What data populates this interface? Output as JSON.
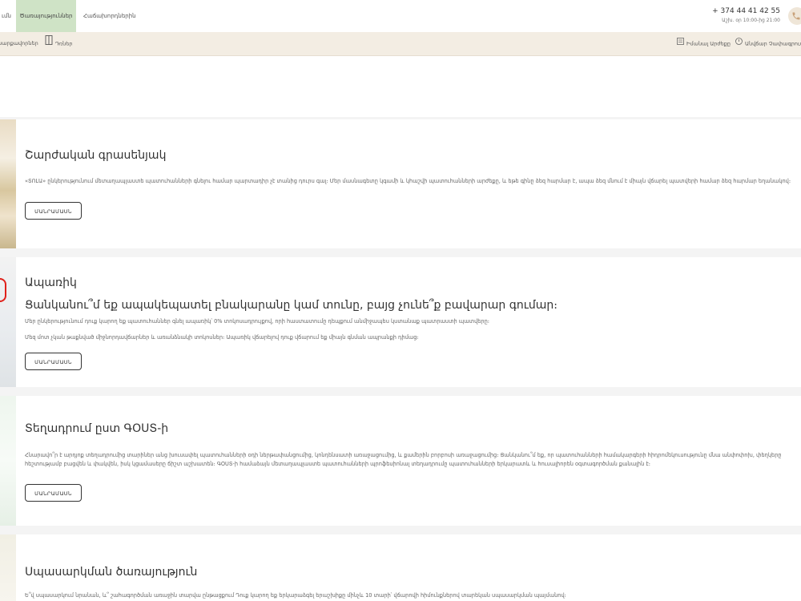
{
  "nav": {
    "items": [
      {
        "label": "ւմն"
      },
      {
        "label": "Ծառայություններ"
      },
      {
        "label": "Հաճախորդներին"
      }
    ]
  },
  "contact": {
    "phone": "+ 374 44 41 42 55",
    "hours": "Աշխ. օր 10:00-ից 21:00"
  },
  "subnav": {
    "left": [
      {
        "label": "սարքավորներ"
      },
      {
        "label": "Դռներ"
      }
    ],
    "right": [
      {
        "label": "Իմանալ Արժեքը"
      },
      {
        "label": "Անվճար Չափագրում"
      }
    ]
  },
  "cards": [
    {
      "title": "Շարժական գրասենյակ",
      "text": "«ՏՈԼԱ» ընկերությունում մետաղապլաստե պատուհանների գնելու համար պարտադիր չէ տանից դուրս գալ։ Մեր մասնագետը կգամի և կհաշվի պատուհանների արժեքը, և եթե գինը ձեզ հարմար է, ապա ձեզ մնում է միայն վճարել պատվերի համար ձեզ հարմար եղանակով։",
      "button": "ՄԱՆՐԱՄԱՍՆ"
    },
    {
      "title": "Ապառիկ",
      "subtitle": "Ցանկանու՞մ եք ապակեպատել բնակարանը կամ տունը, բայց չունե՞ք բավարար գումար։",
      "text": "Մեր ընկերությունում դուք կարող եք պատուհաններ գնել ապառիկ՝ 0% տոկոսադրույքով, որի հաստատումը դեպքում անմիջապես կստանաք պատրաստի պատվերը։",
      "text2": "Մեզ մոտ չկան թաքնված միջնորդավճարներ և առանձնակի տոկոսներ։ Ապառիկ վճարելով դուք վճարում եք միայն գնման ապրանքի դիմաց։",
      "button": "ՄԱՆՐԱՄԱՍՆ"
    },
    {
      "title": "Տեղադրում ըստ ԳՕՍՏ-ի",
      "text": "Հնարավո՞ր է արդյոք տեղադրումից տարիներ անց խուսափել պատուհանների օդի ներթափանցումից, կոնդենսատի առաջացումից, և քամերին բորբոսի առաջացումից։ Ցանկանու՞մ եք, որ պատուհանների համակարգերի հիդրոմեկուսությունը մնա անփոփոխ, փեղկերը հեշտությամբ բացվեն և փակվեն, իսկ կցամասերը ճիշտ աշխատեն։ ԳՕՍՏ-ի համաձայն մետաղապլաստե պատուհանների պրոֆեսիոնալ տեղադրումը պատուհանների երկարատև և հուսալիորեն օգտագործման քանալին է։",
      "button": "ՄԱՆՐԱՄԱՍՆ"
    },
    {
      "title": "Սպասարկման ծառայություն",
      "text": "Ե՞վ սպասարկում նրանան, և՞ շահագործման առաջին տարվա ընթացքում Դուք կարող եք երկարաձգել երաշխիքը մինչև 10 տարի՝ վճարովի հիմունքներով տարեկան սպասարկման պայմանով։"
    }
  ],
  "colors": {
    "accent_green": "#cfe3c6",
    "subbar_beige": "#f3ede3",
    "red_mark": "#e0201a"
  }
}
